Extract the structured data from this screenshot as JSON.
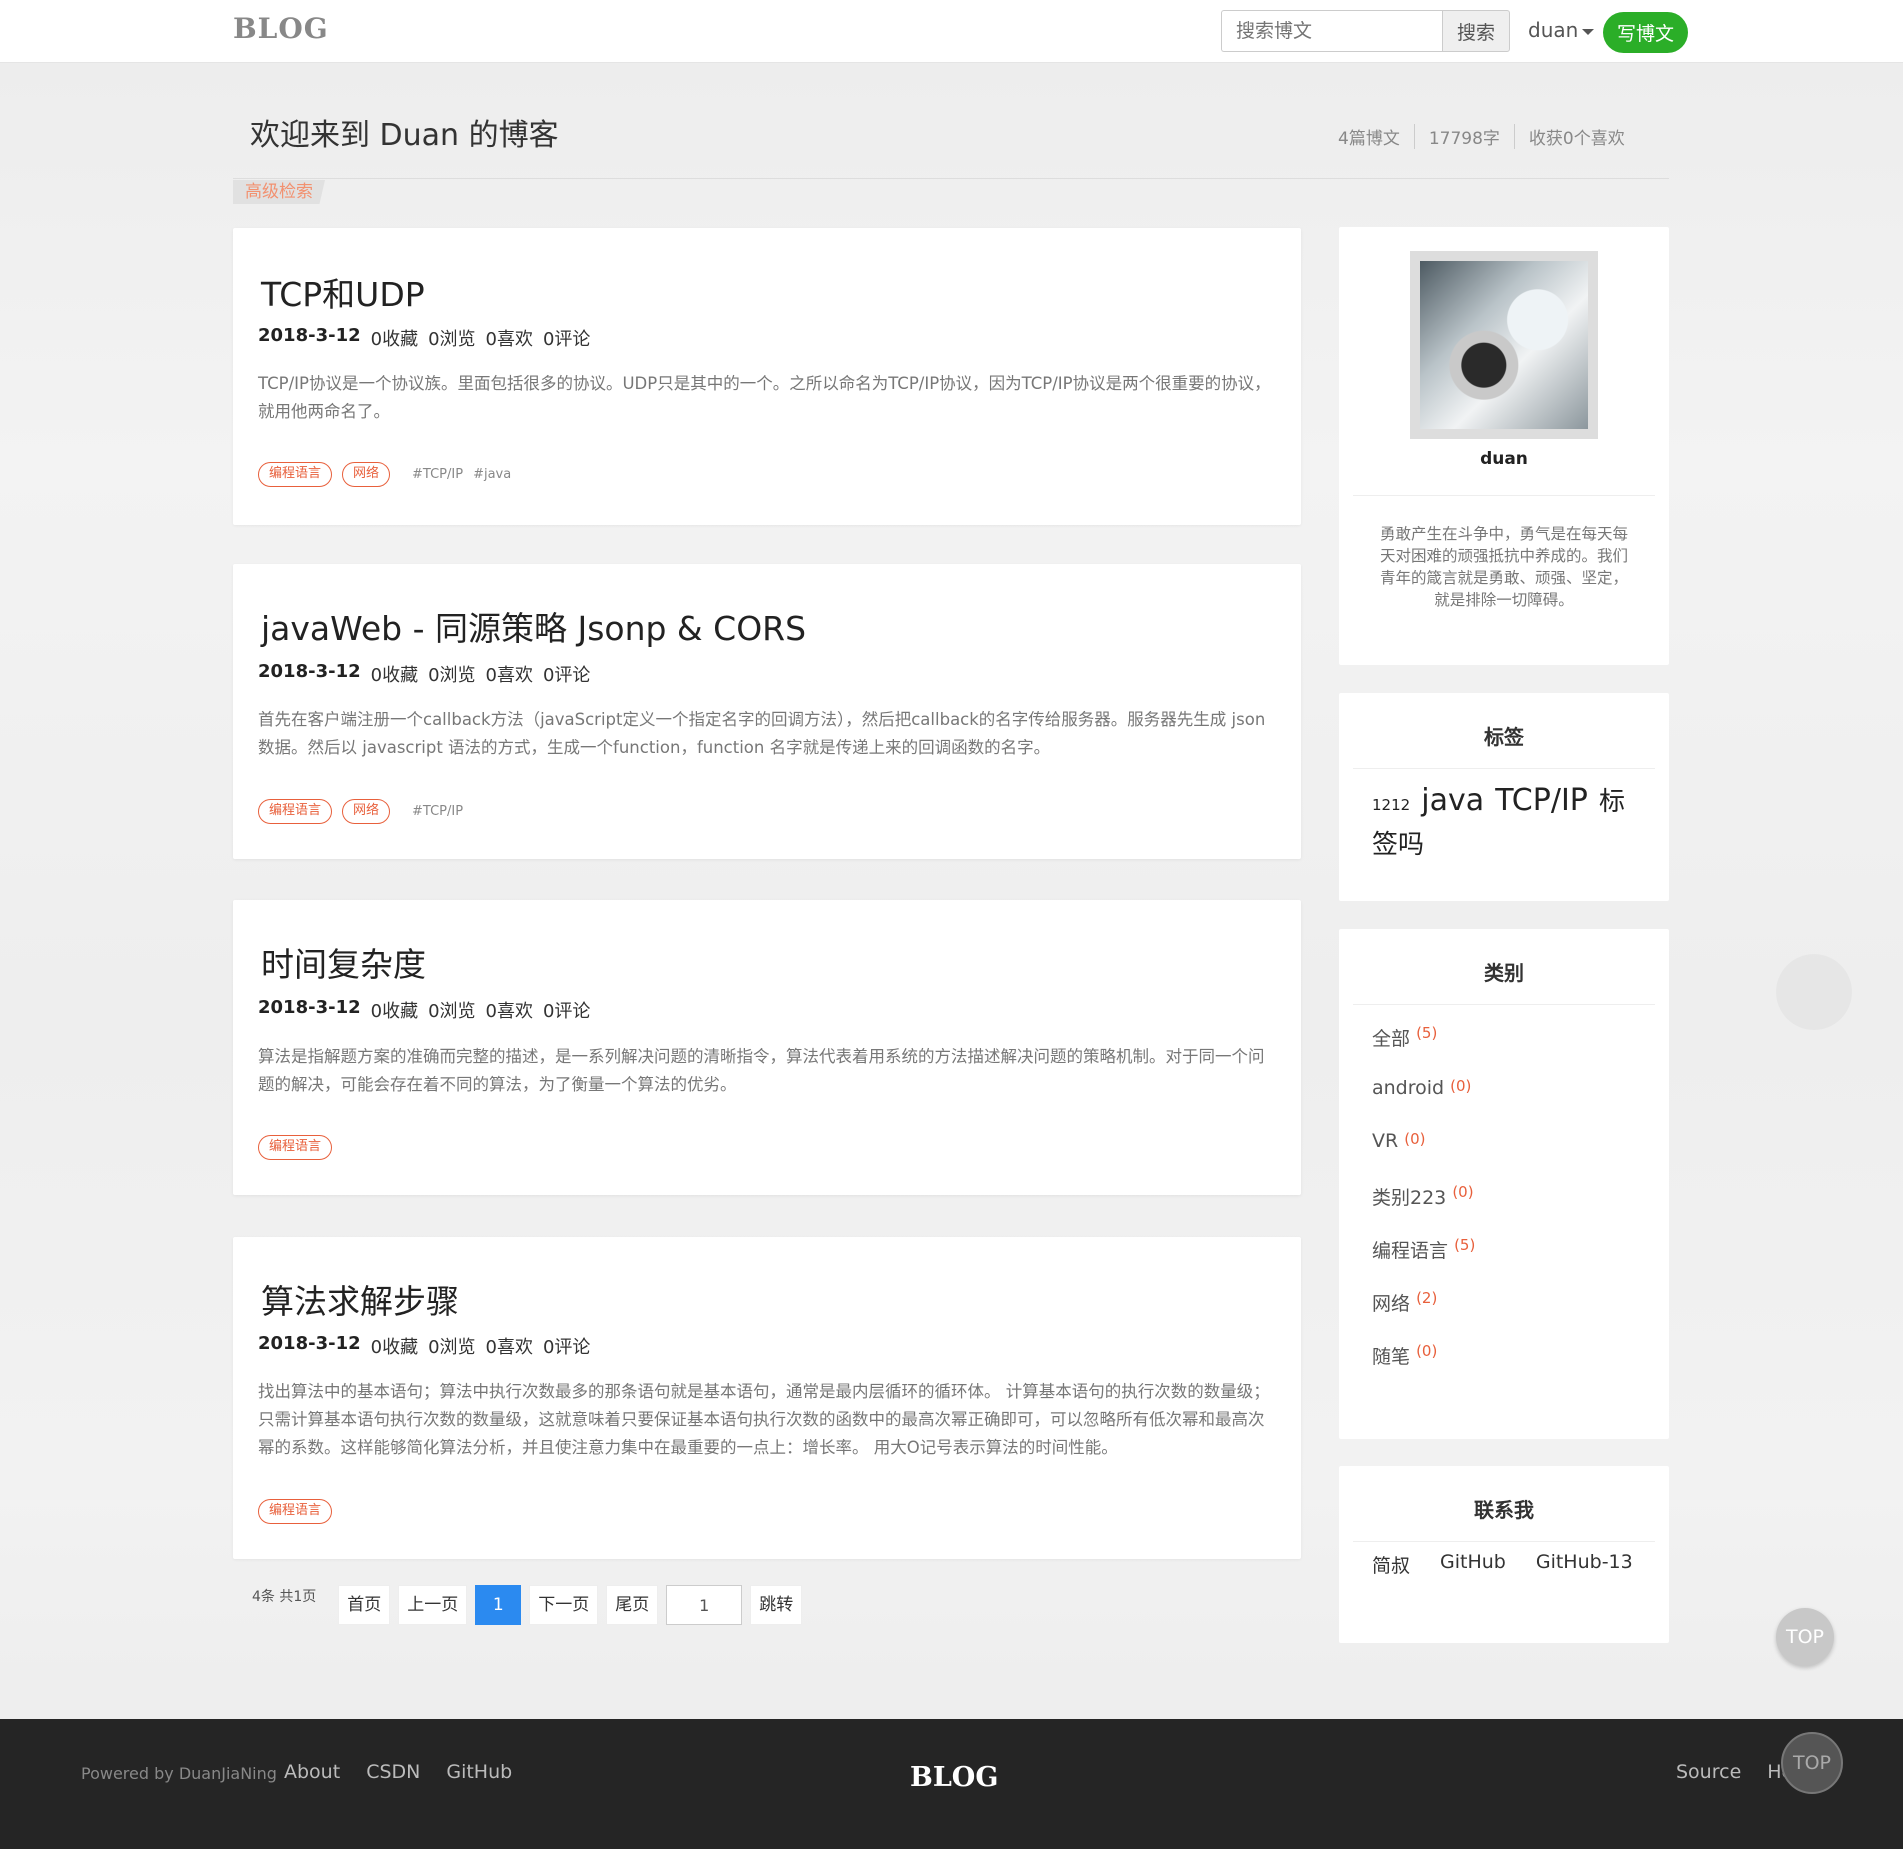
{
  "header": {
    "brand": "BLOG",
    "search_placeholder": "搜索博文",
    "search_button": "搜索",
    "user": "duan",
    "write_button": "写博文"
  },
  "page": {
    "welcome": "欢迎来到 Duan 的博客",
    "stats": {
      "posts": "4篇博文",
      "words": "17798字",
      "likes": "收获0个喜欢"
    },
    "advanced_search": "高级检索"
  },
  "posts": [
    {
      "title": "TCP和UDP",
      "date": "2018-3-12",
      "collects": "0收藏",
      "views": "0浏览",
      "likes": "0喜欢",
      "comments": "0评论",
      "excerpt": "TCP/IP协议是一个协议族。里面包括很多的协议。UDP只是其中的一个。之所以命名为TCP/IP协议，因为TCP/IP协议是两个很重要的协议，就用他两命名了。",
      "categories": [
        "编程语言",
        "网络"
      ],
      "tags": [
        "#TCP/IP",
        "#java"
      ]
    },
    {
      "title": "javaWeb - 同源策略   Jsonp & CORS",
      "date": "2018-3-12",
      "collects": "0收藏",
      "views": "0浏览",
      "likes": "0喜欢",
      "comments": "0评论",
      "excerpt": "首先在客户端注册一个callback方法（javaScript定义一个指定名字的回调方法），然后把callback的名字传给服务器。服务器先生成 json 数据。然后以 javascript 语法的方式，生成一个function，function 名字就是传递上来的回调函数的名字。",
      "categories": [
        "编程语言",
        "网络"
      ],
      "tags": [
        "#TCP/IP"
      ]
    },
    {
      "title": "时间复杂度",
      "date": "2018-3-12",
      "collects": "0收藏",
      "views": "0浏览",
      "likes": "0喜欢",
      "comments": "0评论",
      "excerpt": "算法是指解题方案的准确而完整的描述，是一系列解决问题的清晰指令，算法代表着用系统的方法描述解决问题的策略机制。对于同一个问题的解决，可能会存在着不同的算法，为了衡量一个算法的优劣。",
      "categories": [
        "编程语言"
      ],
      "tags": []
    },
    {
      "title": "算法求解步骤",
      "date": "2018-3-12",
      "collects": "0收藏",
      "views": "0浏览",
      "likes": "0喜欢",
      "comments": "0评论",
      "excerpt": "找出算法中的基本语句；算法中执行次数最多的那条语句就是基本语句，通常是最内层循环的循环体。 计算基本语句的执行次数的数量级；只需计算基本语句执行次数的数量级，这就意味着只要保证基本语句执行次数的函数中的最高次幂正确即可，可以忽略所有低次幂和最高次幂的系数。这样能够简化算法分析，并且使注意力集中在最重要的一点上：增长率。 用大O记号表示算法的时间性能。",
      "categories": [
        "编程语言"
      ],
      "tags": []
    }
  ],
  "pagination": {
    "count": "4条 共1页",
    "first": "首页",
    "prev": "上一页",
    "current": "1",
    "next": "下一页",
    "last": "尾页",
    "jump_value": "1",
    "jump": "跳转"
  },
  "sidebar": {
    "profile": {
      "name": "duan",
      "bio": "勇敢产生在斗争中，勇气是在每天每天对困难的顽强抵抗中养成的。我们青年的箴言就是勇敢、顽强、坚定，就是排除一切障碍。"
    },
    "tags_title": "标签",
    "tags": [
      "1212",
      "java",
      "TCP/IP",
      "标签吗"
    ],
    "categories_title": "类别",
    "categories": [
      {
        "name": "全部",
        "count": "(5)"
      },
      {
        "name": "android",
        "count": "(0)"
      },
      {
        "name": "VR",
        "count": "(0)"
      },
      {
        "name": "类别223",
        "count": "(0)"
      },
      {
        "name": "编程语言",
        "count": "(5)"
      },
      {
        "name": "网络",
        "count": "(2)"
      },
      {
        "name": "随笔",
        "count": "(0)"
      }
    ],
    "contact_title": "联系我",
    "contacts": [
      "简叔",
      "GitHub",
      "GitHub-13"
    ]
  },
  "top_button": "TOP",
  "footer": {
    "powered": "Powered by DuanJiaNing",
    "links": [
      "About",
      "CSDN",
      "GitHub"
    ],
    "brand": "BLOG",
    "right_links": [
      "Source",
      "Help"
    ],
    "top_button": "TOP"
  }
}
